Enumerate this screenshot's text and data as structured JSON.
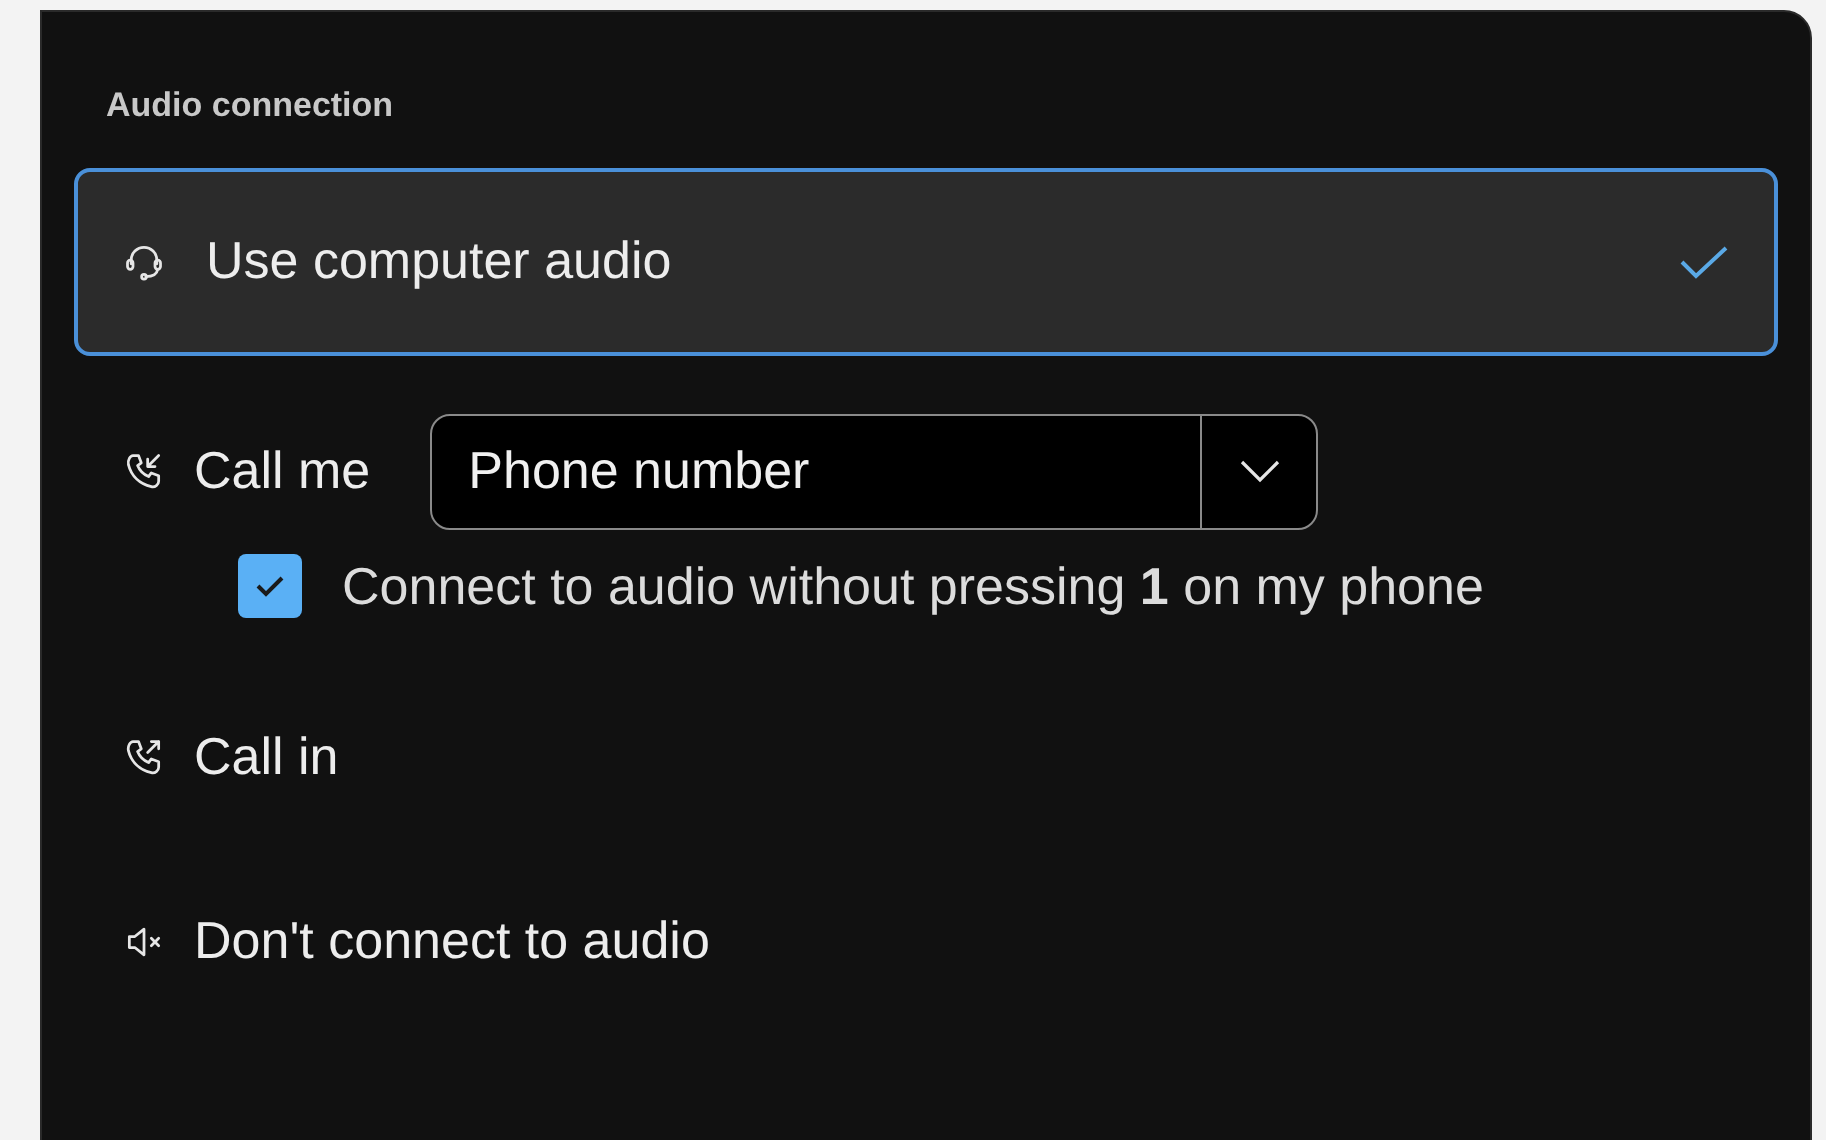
{
  "heading": "Audio connection",
  "options": [
    {
      "kind": "computer",
      "label": "Use computer audio",
      "selected": true
    },
    {
      "kind": "call_me",
      "label": "Call me",
      "selected": false,
      "dropdown": {
        "value": "Phone number"
      },
      "checkbox": {
        "label": "Connect to audio without pressing **1** on my phone",
        "checked": true
      }
    },
    {
      "kind": "call_in",
      "label": "Call in",
      "selected": false
    },
    {
      "kind": "none",
      "label": "Don't connect to audio",
      "selected": false
    }
  ]
}
